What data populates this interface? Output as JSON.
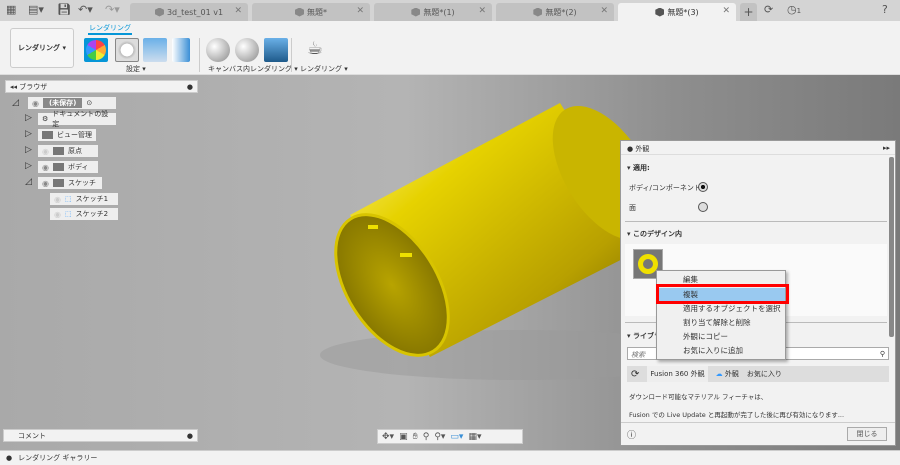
{
  "tabs": [
    {
      "label": "3d_test_01 v1"
    },
    {
      "label": "無題*"
    },
    {
      "label": "無題*(1)"
    },
    {
      "label": "無題*(2)"
    },
    {
      "label": "無題*(3)",
      "active": true
    }
  ],
  "header": {
    "job_count": "1"
  },
  "toolbar": {
    "workspace": "レンダリング",
    "tab": "レンダリング",
    "groups": [
      "設定 ▾",
      "キャンバス内レンダリング ▾",
      "レンダリング ▾"
    ]
  },
  "browser": {
    "title": "ブラウザ",
    "root": "(未保存)",
    "items": [
      "ドキュメントの設定",
      "ビュー管理",
      "原点",
      "ボディ",
      "スケッチ"
    ],
    "sketches": [
      "スケッチ1",
      "スケッチ2"
    ]
  },
  "comment": {
    "title": "コメント"
  },
  "appearance": {
    "title": "外観",
    "apply_section": "適用:",
    "opt_body": "ボディ/コンポーネント",
    "opt_face": "面",
    "design_section": "このデザイン内",
    "library_section": "ライブラリ",
    "search_placeholder": "検索",
    "lib_tabs": [
      "Fusion 360 外観",
      "外観",
      "お気に入り"
    ],
    "msg1": "ダウンロード可能なマテリアル フィーチャは、",
    "msg2": "Fusion での Live Update と再起動が完了した後に再び有効になります...",
    "close": "閉じる"
  },
  "context_menu": {
    "items": [
      "編集",
      "複製",
      "適用するオブジェクトを選択",
      "割り当て解除と削除",
      "外観にコピー",
      "お気に入りに追加"
    ],
    "highlighted": "複製"
  },
  "status": {
    "gallery": "レンダリング ギャラリー"
  },
  "colors": {
    "accent": "#0696d7",
    "highlight": "#99c9f0",
    "callout": "#ff0000",
    "body": "#e6d200"
  }
}
